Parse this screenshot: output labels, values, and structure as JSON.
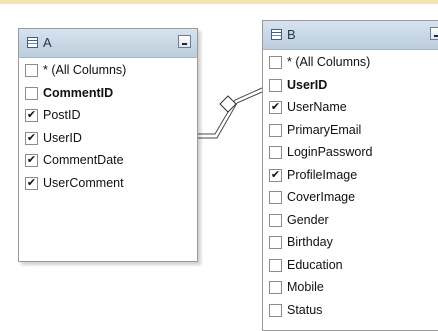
{
  "tableA": {
    "name": "A",
    "columns": [
      {
        "label": "* (All Columns)",
        "checked": false,
        "bold": false
      },
      {
        "label": "CommentID",
        "checked": false,
        "bold": true
      },
      {
        "label": "PostID",
        "checked": true,
        "bold": false
      },
      {
        "label": "UserID",
        "checked": true,
        "bold": false
      },
      {
        "label": "CommentDate",
        "checked": true,
        "bold": false
      },
      {
        "label": "UserComment",
        "checked": true,
        "bold": false
      }
    ]
  },
  "tableB": {
    "name": "B",
    "columns": [
      {
        "label": "* (All Columns)",
        "checked": false,
        "bold": false
      },
      {
        "label": "UserID",
        "checked": false,
        "bold": true
      },
      {
        "label": "UserName",
        "checked": true,
        "bold": false
      },
      {
        "label": "PrimaryEmail",
        "checked": false,
        "bold": false
      },
      {
        "label": "LoginPassword",
        "checked": false,
        "bold": false
      },
      {
        "label": "ProfileImage",
        "checked": true,
        "bold": false
      },
      {
        "label": "CoverImage",
        "checked": false,
        "bold": false
      },
      {
        "label": "Gender",
        "checked": false,
        "bold": false
      },
      {
        "label": "Birthday",
        "checked": false,
        "bold": false
      },
      {
        "label": "Education",
        "checked": false,
        "bold": false
      },
      {
        "label": "Mobile",
        "checked": false,
        "bold": false
      },
      {
        "label": "Status",
        "checked": false,
        "bold": false
      }
    ]
  },
  "icons": {
    "table": "table-icon",
    "minimize": "minimize-icon",
    "check": "✔",
    "relationship": "join-diamond-icon"
  }
}
